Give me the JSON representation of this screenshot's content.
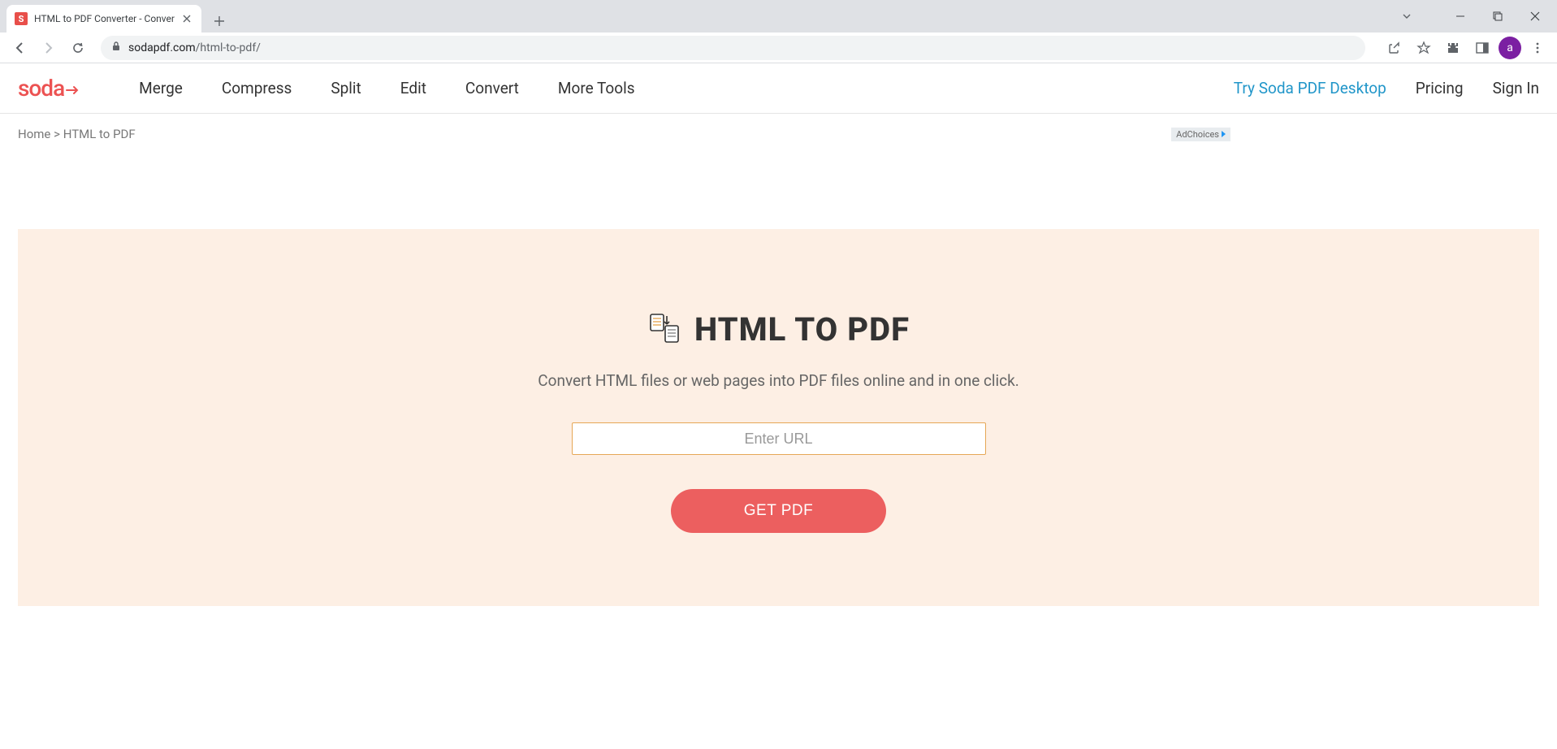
{
  "browser": {
    "tab_title": "HTML to PDF Converter - Conver",
    "tab_favicon_letter": "S",
    "url_host": "sodapdf.com",
    "url_path": "/html-to-pdf/",
    "avatar_letter": "a"
  },
  "header": {
    "logo_text": "soda",
    "nav": [
      "Merge",
      "Compress",
      "Split",
      "Edit",
      "Convert",
      "More Tools"
    ],
    "try_desktop": "Try Soda PDF Desktop",
    "pricing": "Pricing",
    "sign_in": "Sign In"
  },
  "breadcrumb": {
    "home": "Home",
    "sep": ">",
    "current": "HTML to PDF"
  },
  "adchoices_label": "AdChoices",
  "hero": {
    "title": "HTML TO PDF",
    "subtitle": "Convert HTML files or web pages into PDF files online and in one click.",
    "url_placeholder": "Enter URL",
    "button": "GET PDF"
  }
}
